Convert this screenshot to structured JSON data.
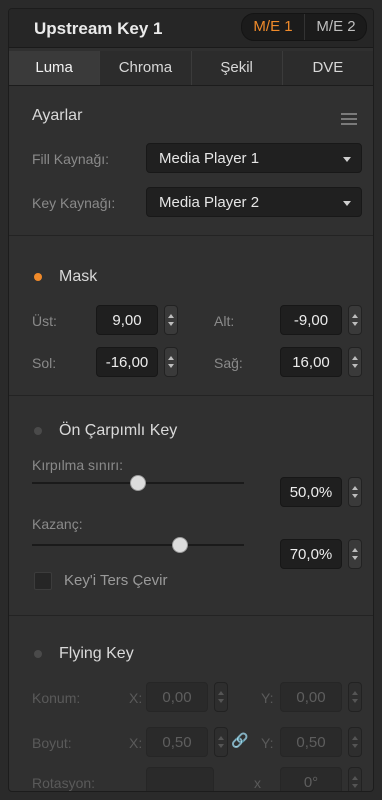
{
  "header": {
    "title": "Upstream Key 1",
    "me1": "M/E 1",
    "me2": "M/E 2"
  },
  "tabs": [
    "Luma",
    "Chroma",
    "Şekil",
    "DVE"
  ],
  "settings": {
    "title": "Ayarlar",
    "fill_label": "Fill Kaynağı:",
    "fill_value": "Media Player 1",
    "key_label": "Key Kaynağı:",
    "key_value": "Media Player 2"
  },
  "mask": {
    "title": "Mask",
    "top_label": "Üst:",
    "top_value": "9,00",
    "bottom_label": "Alt:",
    "bottom_value": "-9,00",
    "left_label": "Sol:",
    "left_value": "-16,00",
    "right_label": "Sağ:",
    "right_value": "16,00"
  },
  "premult": {
    "title": "Ön Çarpımlı Key",
    "clip_label": "Kırpılma sınırı:",
    "clip_value": "50,0%",
    "clip_level": 0.5,
    "gain_label": "Kazanç:",
    "gain_value": "70,0%",
    "gain_level": 0.7,
    "invert_label": "Key'i Ters Çevir"
  },
  "flying": {
    "title": "Flying Key",
    "position_label": "Konum:",
    "x_label": "X:",
    "y_label": "Y:",
    "pos_x": "0,00",
    "pos_y": "0,00",
    "size_label": "Boyut:",
    "size_x": "0,50",
    "size_y": "0,50",
    "rotation_label": "Rotasyon:",
    "x_small": "x",
    "rotation_value": "0°"
  },
  "colors": {
    "accent": "#f08a2a",
    "panel": "#303030"
  }
}
